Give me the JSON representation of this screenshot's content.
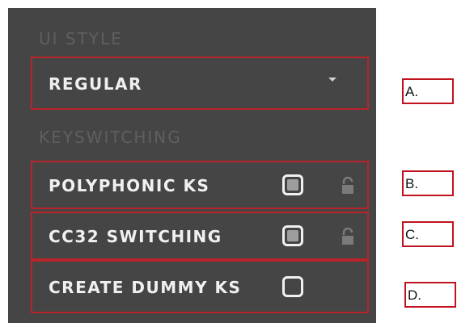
{
  "ui_style": {
    "title": "UI STYLE",
    "selected": "REGULAR"
  },
  "keyswitching": {
    "title": "KEYSWITCHING",
    "rows": [
      {
        "label": "POLYPHONIC KS",
        "checked": true,
        "locked": true
      },
      {
        "label": "CC32 SWITCHING",
        "checked": true,
        "locked": true
      },
      {
        "label": "CREATE DUMMY KS",
        "checked": false,
        "locked": false
      }
    ]
  },
  "callouts": [
    "A.",
    "B.",
    "C.",
    "D."
  ],
  "colors": {
    "panel_bg": "#464545",
    "highlight_border": "#b8242a",
    "text_light": "#f0f0f0",
    "section_title": "#5f5f5f",
    "checkbox_fill": "#9e9e9e"
  },
  "icons": {
    "dropdown": "chevron-down-icon",
    "lock": "open-lock-icon"
  }
}
